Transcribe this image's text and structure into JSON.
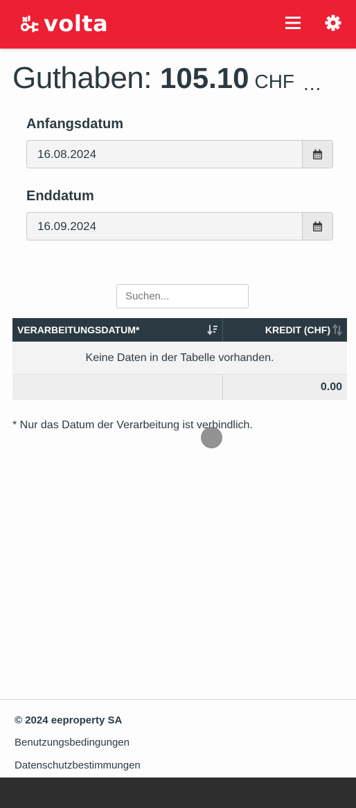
{
  "app": {
    "logo_text": "volta",
    "brand_color": "#ec1f33",
    "dark_color": "#2b3a42"
  },
  "header": {
    "menu_icon": "hamburger-icon",
    "settings_icon": "gear-icon"
  },
  "balance": {
    "label": "Guthaben:",
    "amount": "105.10",
    "currency": "CHF",
    "more": "..."
  },
  "filters": {
    "start_label": "Anfangsdatum",
    "start_value": "16.08.2024",
    "end_label": "Enddatum",
    "end_value": "16.09.2024",
    "calendar_icon": "calendar-icon"
  },
  "search": {
    "placeholder": "Suchen..."
  },
  "table": {
    "columns": [
      "VERARBEITUNGSDATUM*",
      "KREDIT (CHF)"
    ],
    "empty_message": "Keine Daten in der Tabelle vorhanden.",
    "total": "0.00"
  },
  "note": "* Nur das Datum der Verarbeitung ist verbindlich.",
  "footer": {
    "copyright": "© 2024 eeproperty SA",
    "links": [
      "Benutzungsbedingungen",
      "Datenschutzbestimmungen"
    ]
  }
}
